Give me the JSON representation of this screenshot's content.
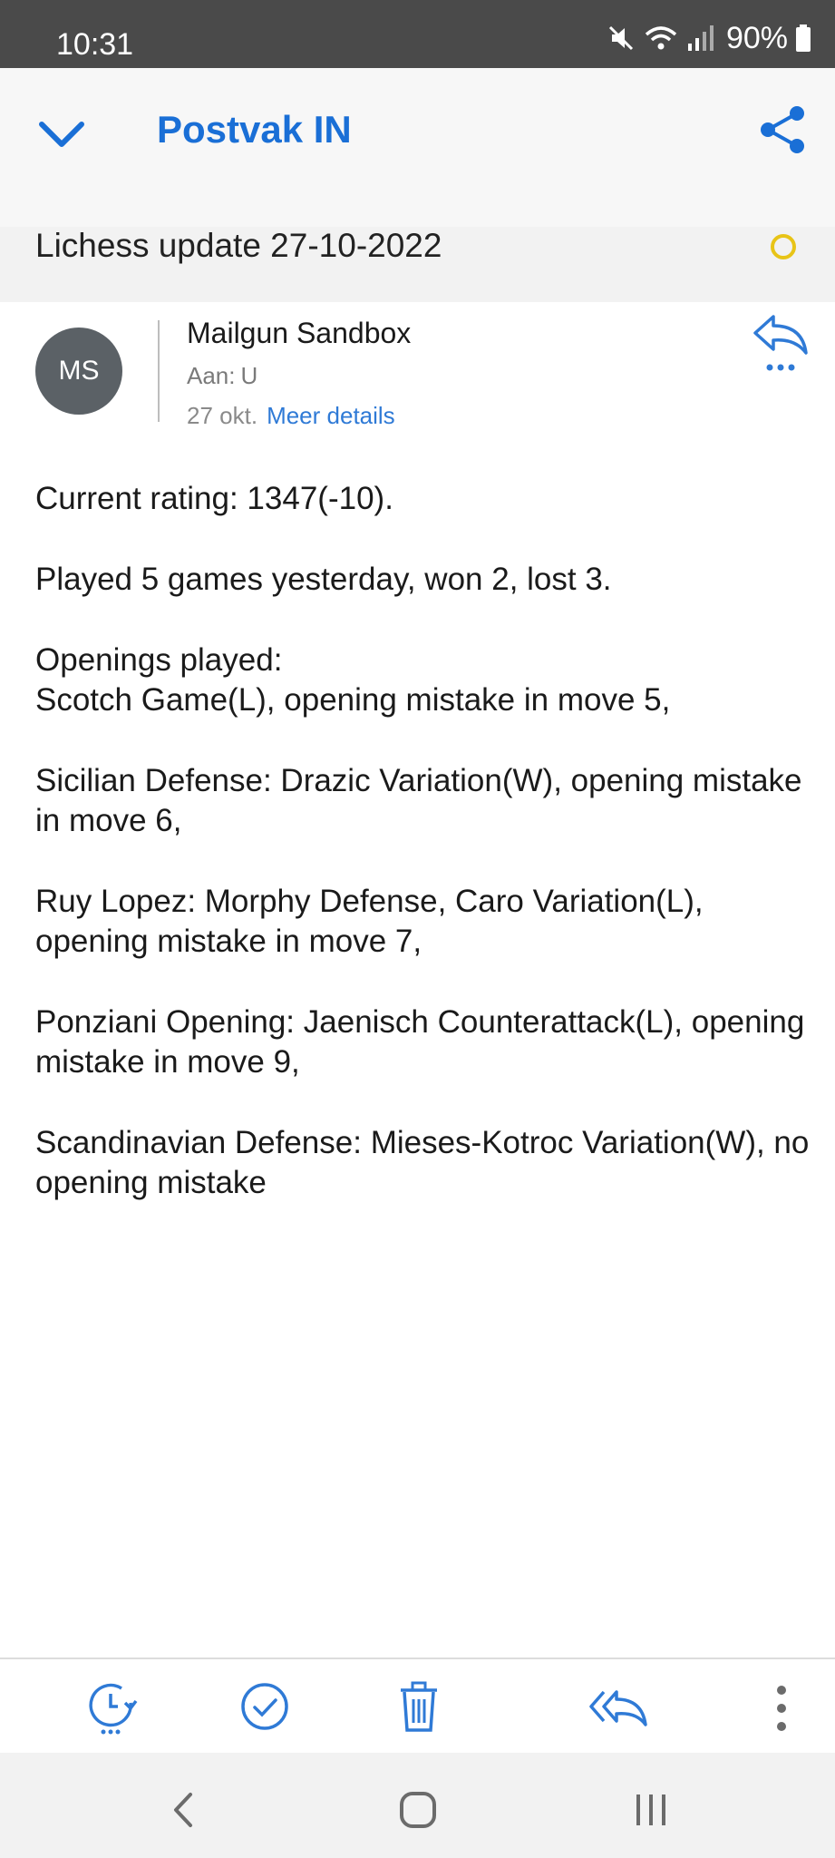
{
  "status_bar": {
    "time": "10:31",
    "battery": "90%",
    "icons": [
      "mute-icon",
      "wifi-icon",
      "signal-icon",
      "battery-icon"
    ]
  },
  "header": {
    "folder_title": "Postvak IN",
    "accent_color": "#1a6fd6"
  },
  "email": {
    "subject": "Lichess update 27-10-2022",
    "flag_color": "#e8c417",
    "sender_initials": "MS",
    "sender_name": "Mailgun Sandbox",
    "recipient_label": "Aan:",
    "recipient_value": "U",
    "date": "27 okt.",
    "details_link": "Meer details",
    "body": {
      "rating": "Current rating: 1347(-10).",
      "summary": "Played 5 games yesterday, won 2, lost 3.",
      "openings_heading": "Openings played:",
      "opening_1": "Scotch Game(L), opening mistake in move 5,",
      "opening_2": "Sicilian Defense: Drazic Variation(W), opening mistake in move 6,",
      "opening_3": "Ruy Lopez: Morphy Defense, Caro Variation(L), opening mistake in move 7,",
      "opening_4": "Ponziani Opening: Jaenisch Counterattack(L), opening mistake in move 9,",
      "opening_5": "Scandinavian Defense: Mieses-Kotroc Variation(W), no opening mistake"
    }
  },
  "toolbar": {
    "buttons": [
      "snooze-icon",
      "mark-done-icon",
      "delete-icon",
      "reply-all-icon",
      "more-options-icon"
    ]
  },
  "navigation": {
    "buttons": [
      "back-icon",
      "home-icon",
      "recent-apps-icon"
    ]
  }
}
